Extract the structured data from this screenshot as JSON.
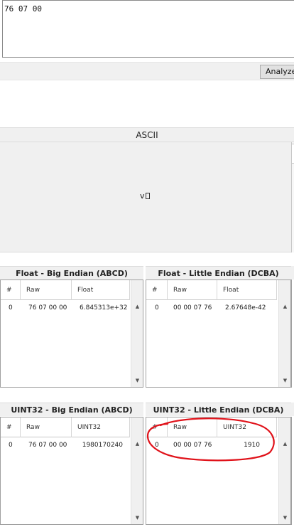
{
  "input": {
    "value": "76 07 00"
  },
  "toolbar": {
    "analyze_label": "Analyze"
  },
  "ascii": {
    "title": "ASCII",
    "text": "v"
  },
  "panels": {
    "float_be": {
      "title": "Float - Big Endian (ABCD)",
      "col_index": "#",
      "col_raw": "Raw",
      "col_value": "Float",
      "rows": [
        {
          "index": "0",
          "raw": "76 07 00 00",
          "value": "6.845313e+32"
        }
      ]
    },
    "float_le": {
      "title": "Float - Little Endian (DCBA)",
      "col_index": "#",
      "col_raw": "Raw",
      "col_value": "Float",
      "rows": [
        {
          "index": "0",
          "raw": "00 00 07 76",
          "value": "2.67648e-42"
        }
      ]
    },
    "uint32_be": {
      "title": "UINT32 - Big Endian (ABCD)",
      "col_index": "#",
      "col_raw": "Raw",
      "col_value": "UINT32",
      "rows": [
        {
          "index": "0",
          "raw": "76 07 00 00",
          "value": "1980170240"
        }
      ]
    },
    "uint32_le": {
      "title": "UINT32 - Little Endian (DCBA)",
      "col_index": "#",
      "col_raw": "Raw",
      "col_value": "UINT32",
      "rows": [
        {
          "index": "0",
          "raw": "00 00 07 76",
          "value": "1910"
        }
      ]
    }
  },
  "icons": {
    "scroll_up": "scroll-up-arrow",
    "scroll_down": "scroll-down-arrow"
  },
  "annotation": {
    "color": "#e0121a"
  }
}
